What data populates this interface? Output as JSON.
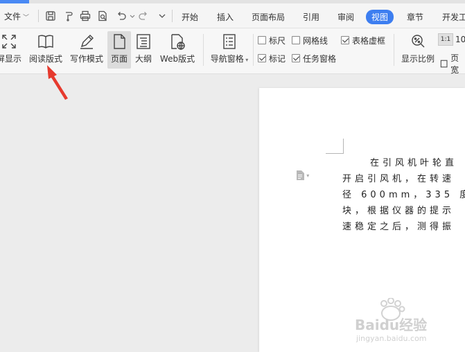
{
  "menubar": {
    "file_label": "文件",
    "tabs": [
      {
        "label": "开始",
        "active": false
      },
      {
        "label": "插入",
        "active": false
      },
      {
        "label": "页面布局",
        "active": false
      },
      {
        "label": "引用",
        "active": false
      },
      {
        "label": "审阅",
        "active": false
      },
      {
        "label": "视图",
        "active": true
      },
      {
        "label": "章节",
        "active": false
      },
      {
        "label": "开发工",
        "active": false
      }
    ],
    "accent_color": "#3d7ef0"
  },
  "ribbon": {
    "fullscreen_label": "屏显示",
    "reading_mode_label": "阅读版式",
    "writing_mode_label": "写作模式",
    "page_label": "页面",
    "outline_label": "大纲",
    "web_layout_label": "Web版式",
    "nav_pane_label": "导航窗格",
    "ruler_label": "标尺",
    "gridlines_label": "网格线",
    "table_gridlines_label": "表格虚框",
    "marks_label": "标记",
    "task_pane_label": "任务窗格",
    "zoom_label": "显示比例",
    "zoom_value_label": "1:1",
    "zoom_percent_label": "10",
    "page_width_label": "页宽",
    "checkboxes": {
      "ruler": false,
      "gridlines": false,
      "table_gridlines": true,
      "marks": true,
      "task_pane": true
    }
  },
  "document": {
    "lines": [
      "在引风机叶轮直",
      "开启引风机，在转速",
      "径 600mm，335 度的",
      "块，根据仪器的提示",
      "速稳定之后，测得振"
    ]
  },
  "watermark": {
    "brand": "Baidu经验",
    "url": "jingyan.baidu.com"
  },
  "annotation": {
    "arrow_color": "#e63a2e"
  }
}
